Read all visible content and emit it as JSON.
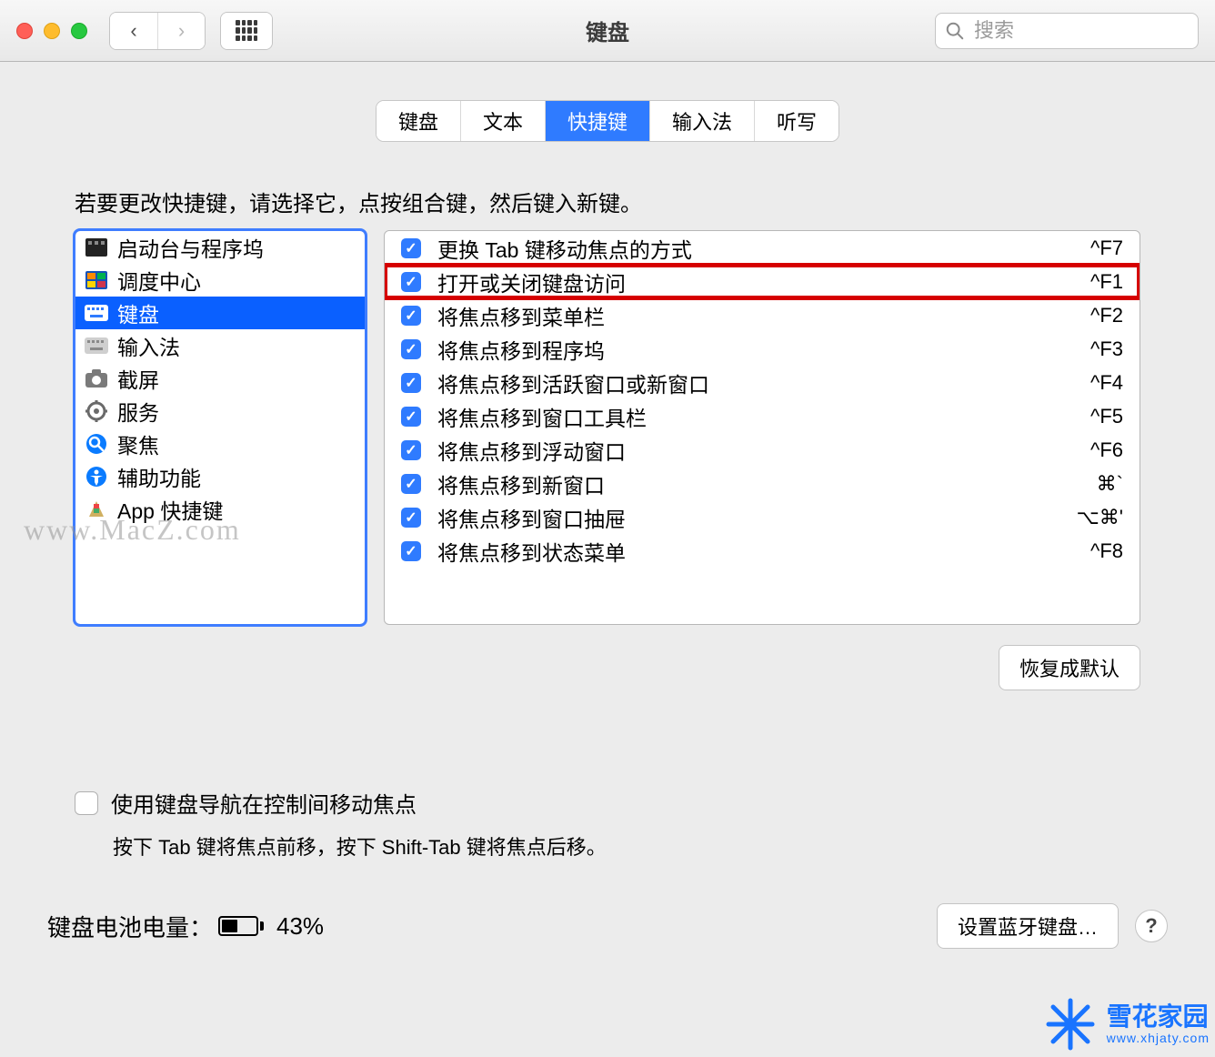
{
  "window": {
    "title": "键盘"
  },
  "search": {
    "placeholder": "搜索"
  },
  "tabs": [
    {
      "label": "键盘",
      "active": false
    },
    {
      "label": "文本",
      "active": false
    },
    {
      "label": "快捷键",
      "active": true
    },
    {
      "label": "输入法",
      "active": false
    },
    {
      "label": "听写",
      "active": false
    }
  ],
  "instruction": "若要更改快捷键，请选择它，点按组合键，然后键入新键。",
  "categories": [
    {
      "label": "启动台与程序坞",
      "selected": false,
      "icon": "launchpad"
    },
    {
      "label": "调度中心",
      "selected": false,
      "icon": "mission"
    },
    {
      "label": "键盘",
      "selected": true,
      "icon": "keyboard"
    },
    {
      "label": "输入法",
      "selected": false,
      "icon": "input"
    },
    {
      "label": "截屏",
      "selected": false,
      "icon": "camera"
    },
    {
      "label": "服务",
      "selected": false,
      "icon": "gear"
    },
    {
      "label": "聚焦",
      "selected": false,
      "icon": "spotlight"
    },
    {
      "label": "辅助功能",
      "selected": false,
      "icon": "a11y"
    },
    {
      "label": "App 快捷键",
      "selected": false,
      "icon": "app"
    }
  ],
  "shortcuts": [
    {
      "checked": true,
      "label": "更换 Tab 键移动焦点的方式",
      "key": "^F7",
      "highlight": false
    },
    {
      "checked": true,
      "label": "打开或关闭键盘访问",
      "key": "^F1",
      "highlight": true
    },
    {
      "checked": true,
      "label": "将焦点移到菜单栏",
      "key": "^F2",
      "highlight": false
    },
    {
      "checked": true,
      "label": "将焦点移到程序坞",
      "key": "^F3",
      "highlight": false
    },
    {
      "checked": true,
      "label": "将焦点移到活跃窗口或新窗口",
      "key": "^F4",
      "highlight": false
    },
    {
      "checked": true,
      "label": "将焦点移到窗口工具栏",
      "key": "^F5",
      "highlight": false
    },
    {
      "checked": true,
      "label": "将焦点移到浮动窗口",
      "key": "^F6",
      "highlight": false
    },
    {
      "checked": true,
      "label": "将焦点移到新窗口",
      "key": "⌘`",
      "highlight": false
    },
    {
      "checked": true,
      "label": "将焦点移到窗口抽屉",
      "key": "⌥⌘'",
      "highlight": false
    },
    {
      "checked": true,
      "label": "将焦点移到状态菜单",
      "key": "^F8",
      "highlight": false
    }
  ],
  "restore_label": "恢复成默认",
  "bottom": {
    "checkbox_label": "使用键盘导航在控制间移动焦点",
    "hint": "按下 Tab 键将焦点前移，按下 Shift-Tab 键将焦点后移。"
  },
  "battery": {
    "label": "键盘电池电量：",
    "percent_text": "43%",
    "percent": 43
  },
  "bluetooth_button": "设置蓝牙键盘…",
  "watermarks": {
    "left": "www.MacZ.com",
    "right_top": "雪花家园",
    "right_sub": "www.xhjaty.com"
  }
}
